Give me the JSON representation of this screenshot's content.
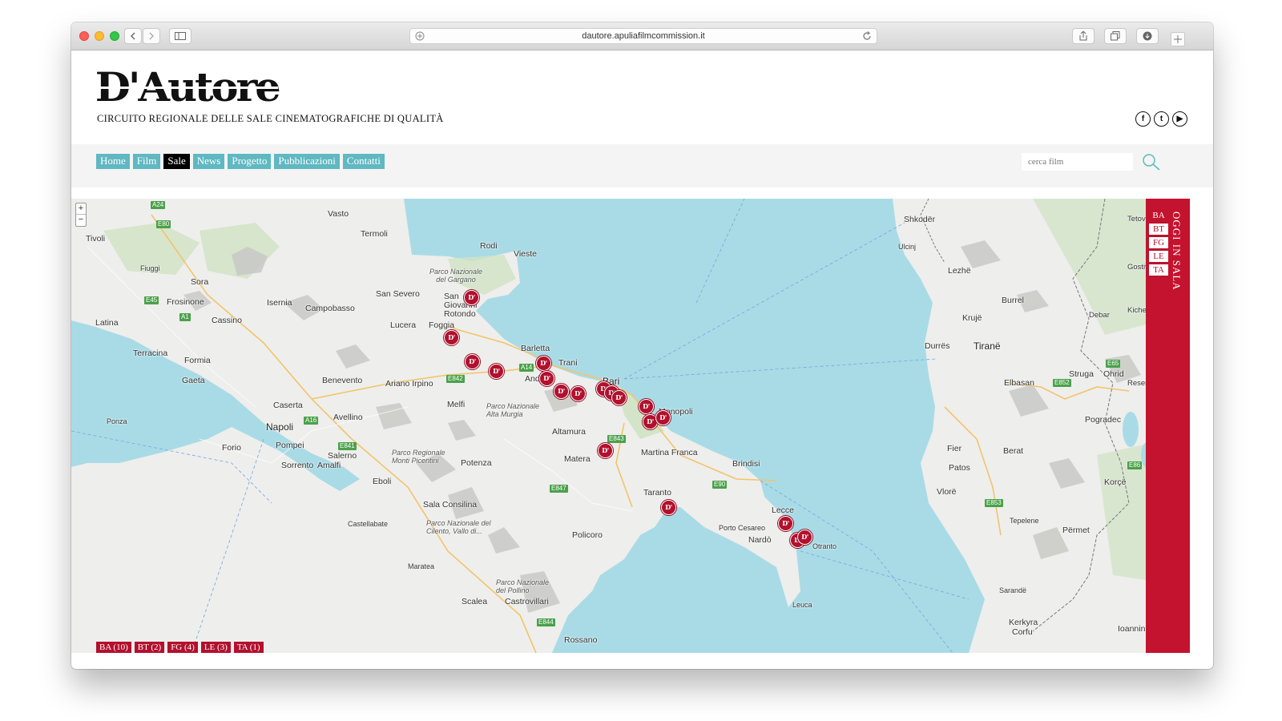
{
  "browser": {
    "url": "dautore.apuliafilmcommission.it"
  },
  "site": {
    "logo": "D'Autore",
    "tagline": "CIRCUITO REGIONALE DELLE SALE CINEMATOGRAFICHE DI QUALITÀ",
    "socials": [
      "facebook-icon",
      "twitter-icon",
      "youtube-icon"
    ]
  },
  "nav": {
    "items": [
      {
        "label": "Home"
      },
      {
        "label": "Film"
      },
      {
        "label": "Sale",
        "active": true
      },
      {
        "label": "News"
      },
      {
        "label": "Progetto"
      },
      {
        "label": "Pubblicazioni"
      },
      {
        "label": "Contatti"
      }
    ],
    "search_placeholder": "cerca film"
  },
  "map": {
    "zoom_in": "+",
    "zoom_out": "−",
    "places": [
      "Vasto",
      "Termoli",
      "Rodi",
      "Vieste",
      "Tivoli",
      "Fiuggi",
      "Sora",
      "Parco Nazionale del Gargano",
      "San Severo",
      "San Giovanni Rotondo",
      "Isernia",
      "Campobasso",
      "Frosinone",
      "Latina",
      "Cassino",
      "Lucera",
      "Foggia",
      "Barletta",
      "Trani",
      "Andria",
      "Bari",
      "Terracina",
      "Formia",
      "Gaeta",
      "Benevento",
      "Ariano Irpino",
      "Caserta",
      "Avellino",
      "Melfi",
      "Parco Nazionale Alta Murgia",
      "Altamura",
      "Napoli",
      "Pompei",
      "Sorrento",
      "Amalfi",
      "Salerno",
      "Parco Regionale Monti Picentini",
      "Potenza",
      "Matera",
      "Martina Franca",
      "Monopoli",
      "Brindisi",
      "Ponza",
      "Forio",
      "Eboli",
      "Taranto",
      "Sala Consilina",
      "Castellabate",
      "Parco Nazionale del Cilento, Vallo di...",
      "Policoro",
      "Lecce",
      "Porto Cesareo",
      "Nardò",
      "Otranto",
      "Maratea",
      "Scalea",
      "Castrovillari",
      "Parco Nazionale del Pollino",
      "Rossano",
      "Leuca",
      "Shkodër",
      "Ulcinj",
      "Lezhë",
      "Burrel",
      "Krujë",
      "Durrës",
      "Tiranë",
      "Elbasan",
      "Fier",
      "Patos",
      "Berat",
      "Vlorë",
      "Tepelene",
      "Përmet",
      "Sarandë",
      "Korçë",
      "Pogradec",
      "Struga",
      "Ohrid",
      "Kerkyra",
      "Corfu",
      "Ioannina",
      "Tetovo",
      "Gostivar",
      "Kichevo",
      "Debar",
      "Resen"
    ],
    "roads": [
      "A24",
      "E80",
      "E45",
      "A1",
      "E842",
      "A14",
      "E843",
      "A16",
      "E841",
      "E847",
      "E90",
      "E844",
      "E852",
      "E853",
      "E65",
      "E86"
    ],
    "pin_label": "D'",
    "pin_count": 24,
    "province_filters": [
      {
        "label": "BA (10)"
      },
      {
        "label": "BT (2)"
      },
      {
        "label": "FG (4)"
      },
      {
        "label": "LE (3)"
      },
      {
        "label": "TA (1)"
      }
    ]
  },
  "side_panel": {
    "tabs": [
      "BA",
      "BT",
      "FG",
      "LE",
      "TA"
    ],
    "title": "OGGI IN SALA"
  },
  "colors": {
    "accent_red": "#c4132e",
    "nav_teal": "#5fb8c2",
    "sea": "#a9dbe6",
    "land": "#eeeeee"
  }
}
